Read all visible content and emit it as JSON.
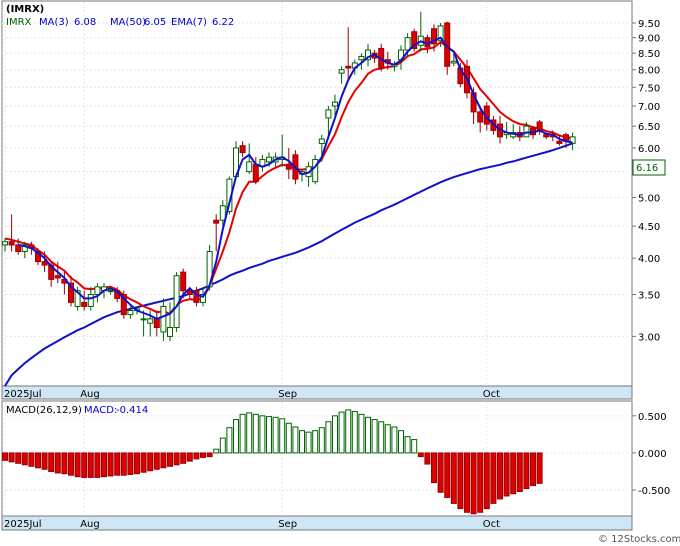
{
  "chart_data": [
    {
      "type": "candlestick",
      "title": "(IMRX)",
      "legend": [
        {
          "label": "IMRX",
          "value": "",
          "color": "#006400"
        },
        {
          "label": "MA(3)",
          "value": "6.08",
          "color": "#0000cc"
        },
        {
          "label": "MA(50)",
          "value": "6.05",
          "color": "#0000cc"
        },
        {
          "label": "EMA(7)",
          "value": "6.22",
          "color": "#0000cc"
        }
      ],
      "y_scale": "log",
      "ylim": [
        2.5,
        10.3
      ],
      "y_ticks": [
        "9.50",
        "9.00",
        "8.50",
        "8.00",
        "7.50",
        "7.00",
        "6.50",
        "6.00",
        "5.50",
        "5.00",
        "4.50",
        "4.00",
        "3.50",
        "3.00"
      ],
      "x_tick_labels": [
        "2025Jul",
        "Aug",
        "Sep",
        "Oct"
      ],
      "x_tick_index": [
        0,
        12,
        42,
        73
      ],
      "last_price": "6.16",
      "colors": {
        "up_fill": "#ffffff",
        "up_stroke": "#006400",
        "down_fill": "#dd0000",
        "down_stroke": "#990000",
        "ema": "#e60000",
        "ma": "#1010cc"
      },
      "ohlc": [
        [
          4.2,
          4.3,
          4.1,
          4.25
        ],
        [
          4.25,
          4.7,
          4.1,
          4.2
        ],
        [
          4.2,
          4.3,
          4.05,
          4.1
        ],
        [
          4.1,
          4.25,
          4.0,
          4.2
        ],
        [
          4.2,
          4.25,
          4.05,
          4.15
        ],
        [
          4.1,
          4.15,
          3.9,
          3.95
        ],
        [
          3.95,
          4.1,
          3.8,
          3.9
        ],
        [
          3.9,
          3.95,
          3.6,
          3.7
        ],
        [
          3.75,
          3.95,
          3.65,
          3.72
        ],
        [
          3.7,
          3.8,
          3.5,
          3.65
        ],
        [
          3.65,
          3.75,
          3.35,
          3.4
        ],
        [
          3.35,
          3.6,
          3.3,
          3.55
        ],
        [
          3.4,
          3.55,
          3.3,
          3.35
        ],
        [
          3.35,
          3.6,
          3.3,
          3.5
        ],
        [
          3.5,
          3.65,
          3.4,
          3.6
        ],
        [
          3.55,
          3.65,
          3.45,
          3.6
        ],
        [
          3.55,
          3.6,
          3.5,
          3.55
        ],
        [
          3.55,
          3.6,
          3.4,
          3.45
        ],
        [
          3.5,
          3.55,
          3.2,
          3.25
        ],
        [
          3.25,
          3.35,
          3.2,
          3.3
        ],
        [
          3.3,
          3.35,
          3.25,
          3.32
        ],
        [
          3.2,
          3.3,
          3.0,
          3.2
        ],
        [
          3.15,
          3.3,
          3.0,
          3.2
        ],
        [
          3.2,
          3.3,
          3.0,
          3.1
        ],
        [
          3.05,
          3.45,
          2.95,
          3.35
        ],
        [
          3.0,
          3.4,
          2.95,
          3.1
        ],
        [
          3.1,
          3.8,
          3.05,
          3.75
        ],
        [
          3.8,
          3.85,
          3.45,
          3.55
        ],
        [
          3.55,
          3.6,
          3.45,
          3.5
        ],
        [
          3.55,
          3.6,
          3.35,
          3.4
        ],
        [
          3.4,
          3.6,
          3.35,
          3.5
        ],
        [
          3.6,
          4.2,
          3.55,
          4.1
        ],
        [
          4.6,
          4.7,
          4.1,
          4.55
        ],
        [
          4.6,
          4.95,
          4.5,
          4.85
        ],
        [
          4.75,
          5.4,
          4.7,
          5.35
        ],
        [
          5.4,
          6.15,
          5.35,
          6.0
        ],
        [
          6.05,
          6.15,
          5.8,
          5.9
        ],
        [
          5.5,
          6.1,
          5.45,
          5.7
        ],
        [
          5.65,
          5.8,
          5.25,
          5.3
        ],
        [
          5.6,
          5.85,
          5.5,
          5.75
        ],
        [
          5.7,
          5.9,
          5.6,
          5.8
        ],
        [
          5.7,
          5.9,
          5.6,
          5.8
        ],
        [
          5.75,
          6.3,
          5.6,
          5.8
        ],
        [
          5.65,
          6.0,
          5.35,
          5.55
        ],
        [
          5.85,
          5.95,
          5.25,
          5.35
        ],
        [
          5.45,
          5.55,
          5.3,
          5.5
        ],
        [
          5.4,
          5.7,
          5.2,
          5.6
        ],
        [
          5.3,
          5.85,
          5.25,
          5.75
        ],
        [
          6.1,
          6.3,
          5.7,
          6.2
        ],
        [
          6.7,
          7.0,
          6.2,
          6.9
        ],
        [
          7.0,
          7.3,
          6.7,
          7.1
        ],
        [
          7.9,
          8.1,
          7.6,
          8.0
        ],
        [
          8.1,
          9.35,
          7.7,
          8.05
        ],
        [
          8.05,
          8.3,
          7.85,
          8.2
        ],
        [
          8.3,
          8.5,
          8.0,
          8.4
        ],
        [
          8.3,
          8.8,
          8.1,
          8.6
        ],
        [
          8.5,
          8.6,
          8.2,
          8.35
        ],
        [
          8.65,
          8.8,
          7.95,
          8.05
        ],
        [
          8.3,
          8.55,
          8.0,
          8.2
        ],
        [
          8.1,
          8.25,
          7.95,
          8.15
        ],
        [
          8.3,
          8.75,
          8.0,
          8.6
        ],
        [
          8.6,
          9.15,
          8.4,
          9.0
        ],
        [
          9.2,
          9.3,
          8.55,
          8.65
        ],
        [
          8.75,
          9.9,
          8.55,
          9.05
        ],
        [
          9.0,
          9.1,
          8.5,
          8.7
        ],
        [
          9.3,
          9.45,
          8.55,
          8.8
        ],
        [
          8.9,
          9.5,
          8.7,
          9.4
        ],
        [
          9.5,
          9.55,
          7.85,
          8.1
        ],
        [
          8.2,
          8.5,
          8.1,
          8.25
        ],
        [
          8.05,
          8.2,
          7.5,
          7.6
        ],
        [
          8.1,
          8.3,
          7.2,
          7.35
        ],
        [
          7.35,
          7.5,
          6.55,
          6.85
        ],
        [
          6.85,
          7.0,
          6.35,
          6.6
        ],
        [
          7.0,
          7.1,
          6.4,
          6.55
        ],
        [
          6.65,
          6.75,
          6.3,
          6.4
        ],
        [
          6.55,
          6.75,
          6.1,
          6.25
        ],
        [
          6.3,
          6.6,
          6.2,
          6.35
        ],
        [
          6.25,
          6.55,
          6.2,
          6.35
        ],
        [
          6.35,
          6.5,
          6.15,
          6.25
        ],
        [
          6.25,
          6.6,
          6.25,
          6.5
        ],
        [
          6.45,
          6.5,
          6.2,
          6.3
        ],
        [
          6.6,
          6.65,
          6.3,
          6.4
        ],
        [
          6.3,
          6.35,
          6.2,
          6.25
        ],
        [
          6.3,
          6.4,
          6.15,
          6.25
        ],
        [
          6.15,
          6.3,
          6.05,
          6.1
        ],
        [
          6.3,
          6.35,
          6.0,
          6.15
        ],
        [
          6.1,
          6.35,
          5.95,
          6.25
        ]
      ],
      "ma50": [
        2.5,
        2.6,
        2.66,
        2.72,
        2.77,
        2.82,
        2.87,
        2.91,
        2.95,
        2.99,
        3.03,
        3.07,
        3.1,
        3.14,
        3.18,
        3.22,
        3.25,
        3.28,
        3.3,
        3.32,
        3.34,
        3.36,
        3.38,
        3.4,
        3.42,
        3.44,
        3.46,
        3.48,
        3.51,
        3.55,
        3.58,
        3.62,
        3.66,
        3.7,
        3.75,
        3.79,
        3.82,
        3.86,
        3.89,
        3.92,
        3.96,
        3.99,
        4.02,
        4.05,
        4.08,
        4.12,
        4.16,
        4.21,
        4.26,
        4.32,
        4.38,
        4.44,
        4.5,
        4.56,
        4.61,
        4.66,
        4.71,
        4.77,
        4.82,
        4.87,
        4.93,
        4.99,
        5.05,
        5.11,
        5.17,
        5.23,
        5.29,
        5.34,
        5.39,
        5.43,
        5.47,
        5.51,
        5.55,
        5.58,
        5.61,
        5.64,
        5.68,
        5.71,
        5.75,
        5.79,
        5.83,
        5.87,
        5.91,
        5.95,
        6.0,
        6.05,
        6.1
      ],
      "ma3": [
        null,
        null,
        4.2,
        4.18,
        4.15,
        4.08,
        4.0,
        3.88,
        3.8,
        3.72,
        3.6,
        3.53,
        3.45,
        3.45,
        3.48,
        3.55,
        3.58,
        3.54,
        3.45,
        3.37,
        3.3,
        3.27,
        3.24,
        3.2,
        3.23,
        3.26,
        3.35,
        3.5,
        3.58,
        3.5,
        3.47,
        3.62,
        3.95,
        4.45,
        4.9,
        5.4,
        5.75,
        5.85,
        5.65,
        5.6,
        5.65,
        5.75,
        5.8,
        5.72,
        5.58,
        5.45,
        5.48,
        5.6,
        5.8,
        6.25,
        6.7,
        7.25,
        7.7,
        8.05,
        8.2,
        8.38,
        8.45,
        8.32,
        8.2,
        8.15,
        8.28,
        8.55,
        8.75,
        8.88,
        8.8,
        8.9,
        9.0,
        8.7,
        8.55,
        8.0,
        7.75,
        7.3,
        6.95,
        6.7,
        6.55,
        6.42,
        6.35,
        6.32,
        6.3,
        6.35,
        6.35,
        6.4,
        6.32,
        6.3,
        6.2,
        6.15,
        6.12
      ],
      "ema7": [
        4.3,
        4.28,
        4.25,
        4.22,
        4.2,
        4.12,
        4.05,
        3.95,
        3.88,
        3.82,
        3.72,
        3.66,
        3.58,
        3.57,
        3.58,
        3.59,
        3.6,
        3.56,
        3.49,
        3.44,
        3.4,
        3.35,
        3.32,
        3.28,
        3.29,
        3.26,
        3.37,
        3.42,
        3.44,
        3.43,
        3.45,
        3.61,
        3.85,
        4.1,
        4.4,
        4.8,
        5.1,
        5.3,
        5.3,
        5.41,
        5.51,
        5.58,
        5.64,
        5.62,
        5.55,
        5.54,
        5.56,
        5.61,
        5.76,
        6.04,
        6.31,
        6.72,
        7.1,
        7.4,
        7.62,
        7.88,
        8.0,
        8.04,
        8.08,
        8.1,
        8.22,
        8.41,
        8.47,
        8.62,
        8.64,
        8.68,
        8.86,
        8.7,
        8.55,
        8.3,
        8.05,
        7.75,
        7.45,
        7.25,
        7.05,
        6.85,
        6.72,
        6.62,
        6.55,
        6.53,
        6.47,
        6.45,
        6.38,
        6.35,
        6.28,
        6.24,
        6.22
      ]
    },
    {
      "type": "bar",
      "title": "MACD(26,12,9)",
      "legend_label": "MACD:",
      "legend_value": "-0.414",
      "ylim": [
        -0.85,
        0.7
      ],
      "y_ticks": [
        "0.500",
        "0.000",
        "-0.500"
      ],
      "x_tick_labels": [
        "2025Jul",
        "Aug",
        "Sep",
        "Oct"
      ],
      "colors": {
        "positive": "#ffffff",
        "positive_stroke": "#006400",
        "negative": "#dd0000",
        "negative_stroke": "#990000"
      },
      "values": [
        -0.1,
        -0.12,
        -0.14,
        -0.16,
        -0.18,
        -0.2,
        -0.22,
        -0.25,
        -0.27,
        -0.28,
        -0.3,
        -0.32,
        -0.33,
        -0.33,
        -0.33,
        -0.32,
        -0.31,
        -0.3,
        -0.3,
        -0.29,
        -0.28,
        -0.26,
        -0.24,
        -0.22,
        -0.2,
        -0.18,
        -0.16,
        -0.14,
        -0.11,
        -0.08,
        -0.06,
        -0.05,
        0.05,
        0.2,
        0.34,
        0.45,
        0.52,
        0.54,
        0.52,
        0.5,
        0.49,
        0.48,
        0.46,
        0.4,
        0.35,
        0.3,
        0.28,
        0.3,
        0.34,
        0.42,
        0.5,
        0.55,
        0.58,
        0.56,
        0.52,
        0.48,
        0.45,
        0.42,
        0.38,
        0.35,
        0.3,
        0.22,
        0.18,
        -0.05,
        -0.15,
        -0.4,
        -0.53,
        -0.6,
        -0.68,
        -0.75,
        -0.8,
        -0.82,
        -0.8,
        -0.75,
        -0.68,
        -0.62,
        -0.58,
        -0.55,
        -0.52,
        -0.48,
        -0.44,
        -0.41
      ]
    }
  ],
  "watermark": "© 12Stocks.com"
}
